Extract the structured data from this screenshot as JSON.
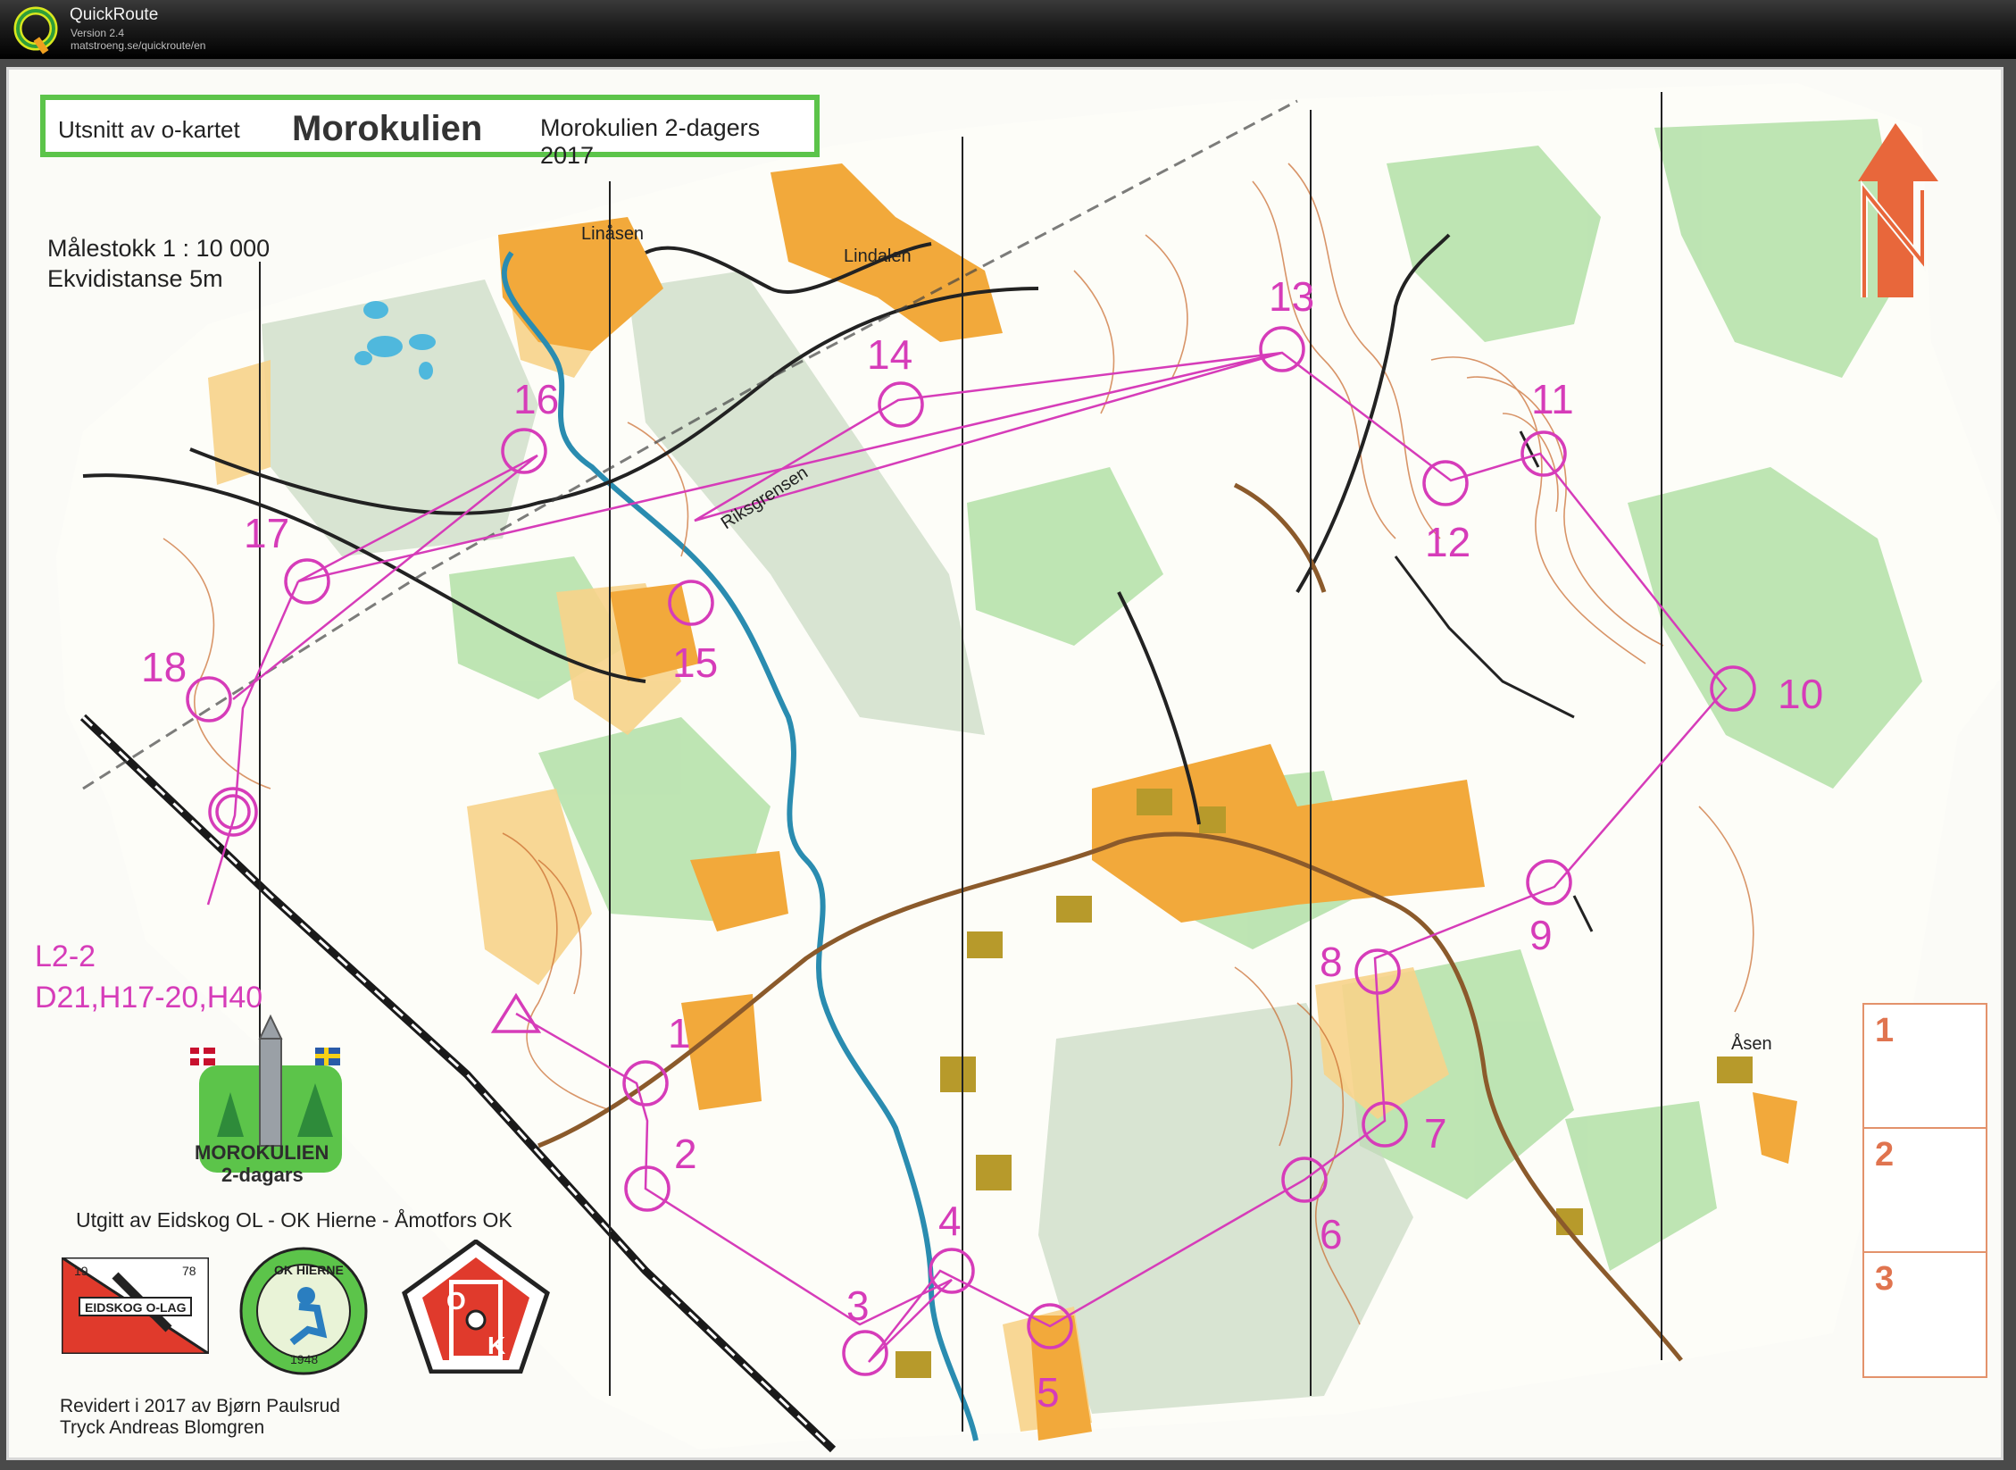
{
  "app": {
    "title": "QuickRoute",
    "version": "Version 2.4",
    "url": "matstroeng.se/quickroute/en"
  },
  "map": {
    "header": {
      "left": "Utsnitt av o-kartet",
      "title": "Morokulien",
      "right": "Morokulien 2-dagers 2017"
    },
    "scale": "Målestokk   1 : 10 000",
    "contour": "Ekvidistanse   5m",
    "class_line1": "L2-2",
    "class_line2": "D21,H17-20,H40",
    "event_logo_line1": "MOROKULIEN",
    "event_logo_line2": "2-dagars",
    "publisher": "Utgitt av Eidskog OL - OK Hierne - Åmotfors OK",
    "club1": {
      "top_left": "19",
      "top_right": "78",
      "name": "EIDSKOG O-LAG"
    },
    "club2": {
      "name": "OK HIERNE",
      "year": "1948"
    },
    "club3": {
      "letters_top": "O",
      "letters_bottom": "K"
    },
    "revised": "Revidert i 2017 av Bjørn Paulsrud",
    "print": "Tryck Andreas Blomgren",
    "places": {
      "linasen": "Linåsen",
      "lindalen": "Lindalen",
      "riksgrensen": "Riksgrensen",
      "asen": "Åsen"
    },
    "lanes": [
      "1",
      "2",
      "3"
    ],
    "controls": [
      "1",
      "2",
      "3",
      "4",
      "5",
      "6",
      "7",
      "8",
      "9",
      "10",
      "11",
      "12",
      "13",
      "14",
      "15",
      "16",
      "17",
      "18"
    ],
    "colors": {
      "course": "#d63cb9",
      "field": "#f2a93b",
      "forest_green": "#8fd08a",
      "water": "#9fd7e8",
      "contour": "#c9692c"
    }
  }
}
